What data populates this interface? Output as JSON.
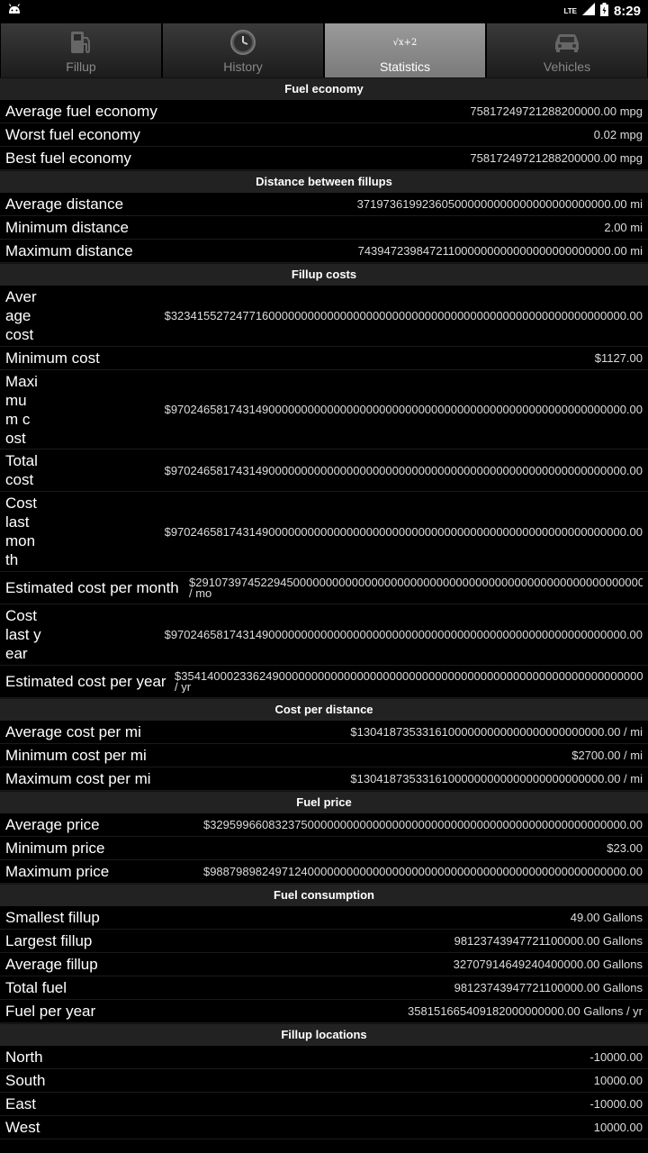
{
  "status": {
    "network": "LTE",
    "time": "8:29"
  },
  "tabs": [
    {
      "label": "Fillup",
      "icon": "gas-pump-icon"
    },
    {
      "label": "History",
      "icon": "clock-icon"
    },
    {
      "label": "Statistics",
      "icon": "formula-icon",
      "formula_text": "√x+2"
    },
    {
      "label": "Vehicles",
      "icon": "car-icon"
    }
  ],
  "sections": {
    "fuel_economy": {
      "title": "Fuel economy",
      "rows": [
        {
          "label": "Average fuel economy",
          "value": "75817249721288200000.00 mpg"
        },
        {
          "label": "Worst fuel economy",
          "value": "0.02 mpg"
        },
        {
          "label": "Best fuel economy",
          "value": "75817249721288200000.00 mpg"
        }
      ]
    },
    "distance": {
      "title": "Distance between fillups",
      "rows": [
        {
          "label": "Average distance",
          "value": "371973619923605000000000000000000000000.00 mi"
        },
        {
          "label": "Minimum distance",
          "value": "2.00 mi"
        },
        {
          "label": "Maximum distance",
          "value": "743947239847211000000000000000000000000.00 mi"
        }
      ]
    },
    "fillup_costs": {
      "title": "Fillup costs",
      "rows": [
        {
          "label": "Average cost",
          "value": "$3234155272477160000000000000000000000000000000000000000000000000000000.00"
        },
        {
          "label": "Minimum cost",
          "value": "$1127.00"
        },
        {
          "label": "Maximum cost",
          "value": "$9702465817431490000000000000000000000000000000000000000000000000000000.00"
        },
        {
          "label": "Total cost",
          "value": "$9702465817431490000000000000000000000000000000000000000000000000000000.00"
        },
        {
          "label": "Cost last month",
          "value": "$9702465817431490000000000000000000000000000000000000000000000000000000.00"
        },
        {
          "label": "Estimated cost per month",
          "value": "$29107397452294500000000000000000000000000000000000000000000000000000000 / mo"
        },
        {
          "label": "Cost last year",
          "value": "$9702465817431490000000000000000000000000000000000000000000000000000000.00"
        },
        {
          "label": "Estimated cost per year",
          "value": "$35414000233624900000000000000000000000000000000000000000000000000000000 / yr"
        }
      ]
    },
    "cost_per_distance": {
      "title": "Cost per distance",
      "rows": [
        {
          "label": "Average cost per mi",
          "value": "$13041873533161000000000000000000000000.00 / mi"
        },
        {
          "label": "Minimum cost per mi",
          "value": "$2700.00 / mi"
        },
        {
          "label": "Maximum cost per mi",
          "value": "$13041873533161000000000000000000000000.00 / mi"
        }
      ]
    },
    "fuel_price": {
      "title": "Fuel price",
      "rows": [
        {
          "label": "Average price",
          "value": "$3295996608323750000000000000000000000000000000000000000000000000.00"
        },
        {
          "label": "Minimum price",
          "value": "$23.00"
        },
        {
          "label": "Maximum price",
          "value": "$9887989824971240000000000000000000000000000000000000000000000000.00"
        }
      ]
    },
    "fuel_consumption": {
      "title": "Fuel consumption",
      "rows": [
        {
          "label": "Smallest fillup",
          "value": "49.00 Gallons"
        },
        {
          "label": "Largest fillup",
          "value": "98123743947721100000.00 Gallons"
        },
        {
          "label": "Average fillup",
          "value": "32707914649240400000.00 Gallons"
        },
        {
          "label": "Total fuel",
          "value": "98123743947721100000.00 Gallons"
        },
        {
          "label": "Fuel per year",
          "value": "358151665409182000000000.00 Gallons / yr"
        }
      ]
    },
    "fillup_locations": {
      "title": "Fillup locations",
      "rows": [
        {
          "label": "North",
          "value": "-10000.00"
        },
        {
          "label": "South",
          "value": "10000.00"
        },
        {
          "label": "East",
          "value": "-10000.00"
        },
        {
          "label": "West",
          "value": "10000.00"
        }
      ]
    }
  }
}
